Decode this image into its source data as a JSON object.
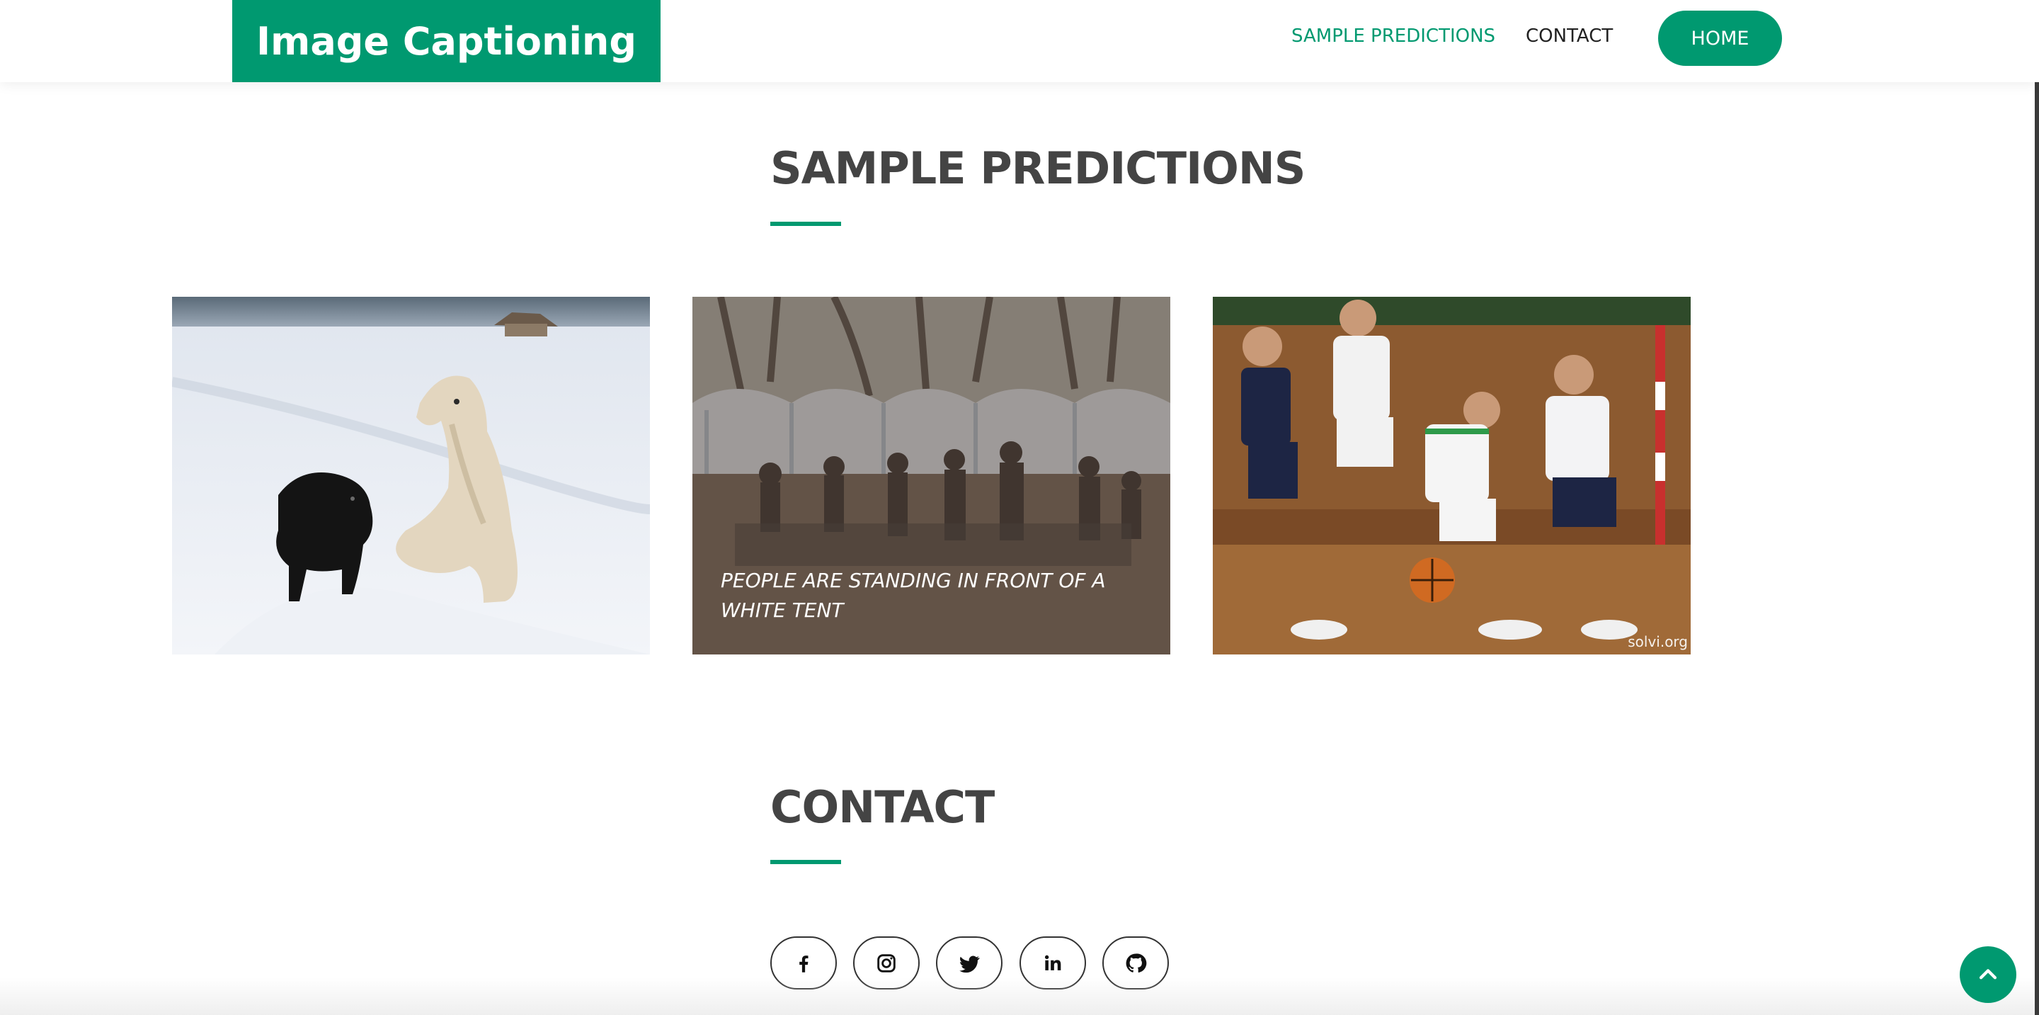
{
  "header": {
    "logo": "Image Captioning",
    "nav": {
      "sample_predictions": "SAMPLE PREDICTIONS",
      "contact": "CONTACT",
      "home": "HOME"
    }
  },
  "sections": {
    "predictions": {
      "title": "SAMPLE PREDICTIONS",
      "cards": [
        {
          "caption": "",
          "watermark": ""
        },
        {
          "caption": "PEOPLE ARE STANDING IN FRONT OF A WHITE TENT",
          "watermark": ""
        },
        {
          "caption": "",
          "watermark": "solvi.org"
        }
      ]
    },
    "contact": {
      "title": "CONTACT",
      "social": [
        "facebook-icon",
        "instagram-icon",
        "twitter-icon",
        "linkedin-icon",
        "github-icon"
      ]
    }
  },
  "colors": {
    "accent": "#009970",
    "heading": "#444444",
    "nav": "#222222"
  },
  "icons": {
    "back_to_top": "chevron-up-icon"
  }
}
